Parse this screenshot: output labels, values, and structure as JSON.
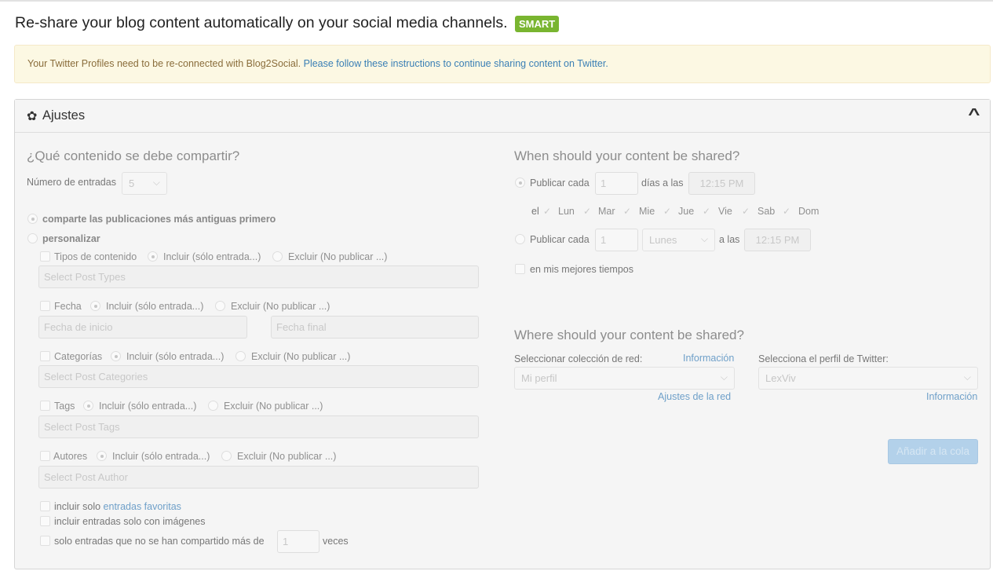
{
  "header": {
    "title": "Re-share your blog content automatically on your social media channels.",
    "badge": "SMART"
  },
  "notice": {
    "text": "Your Twitter Profiles need to be re-connected with Blog2Social.",
    "link": "Please follow these instructions to continue sharing content on Twitter."
  },
  "panel": {
    "title": "Ajustes"
  },
  "what": {
    "heading": "¿Qué contenido se debe compartir?",
    "num_label": "Número de entradas",
    "num_value": "5",
    "opt_oldest": "comparte las publicaciones más antiguas primero",
    "opt_custom": "personalizar",
    "filters": [
      {
        "label": "Tipos de contenido",
        "include": "Incluir (sólo entrada...)",
        "exclude": "Excluir (No publicar ...)",
        "placeholder": "Select Post Types"
      },
      {
        "label": "Fecha",
        "include": "Incluir (sólo entrada...)",
        "exclude": "Excluir (No publicar ...)",
        "placeholder_start": "Fecha de inicio",
        "placeholder_end": "Fecha final"
      },
      {
        "label": "Categorías",
        "include": "Incluir (sólo entrada...)",
        "exclude": "Excluir (No publicar ...)",
        "placeholder": "Select Post Categories"
      },
      {
        "label": "Tags",
        "include": "Incluir (sólo entrada...)",
        "exclude": "Excluir (No publicar ...)",
        "placeholder": "Select Post Tags"
      },
      {
        "label": "Autores",
        "include": "Incluir (sólo entrada...)",
        "exclude": "Excluir (No publicar ...)",
        "placeholder": "Select Post Author"
      }
    ],
    "fav_prefix": "incluir solo",
    "fav_link": "entradas favoritas",
    "images": "incluir entradas solo con imágenes",
    "shared_prefix": "solo entradas que no se han compartido más de",
    "shared_value": "1",
    "shared_suffix": "veces"
  },
  "when": {
    "heading": "When should your content be shared?",
    "publish_every": "Publicar cada",
    "days_value": "1",
    "days_at": "días a las",
    "time1": "12:15 PM",
    "on_label": "el",
    "days": [
      "Lun",
      "Mar",
      "Mie",
      "Jue",
      "Vie",
      "Sab",
      "Dom"
    ],
    "week_value": "1",
    "weekday": "Lunes",
    "at_label": "a las",
    "time2": "12:15 PM",
    "best_times": "en mis mejores tiempos"
  },
  "where": {
    "heading": "Where should your content be shared?",
    "network_label": "Seleccionar colección de red:",
    "network_info": "Información",
    "network_value": "Mi perfil",
    "network_settings": "Ajustes de la red",
    "twitter_label": "Selecciona el perfil de Twitter:",
    "twitter_value": "LexViv",
    "twitter_info": "Información",
    "submit": "Añadir a la cola"
  }
}
